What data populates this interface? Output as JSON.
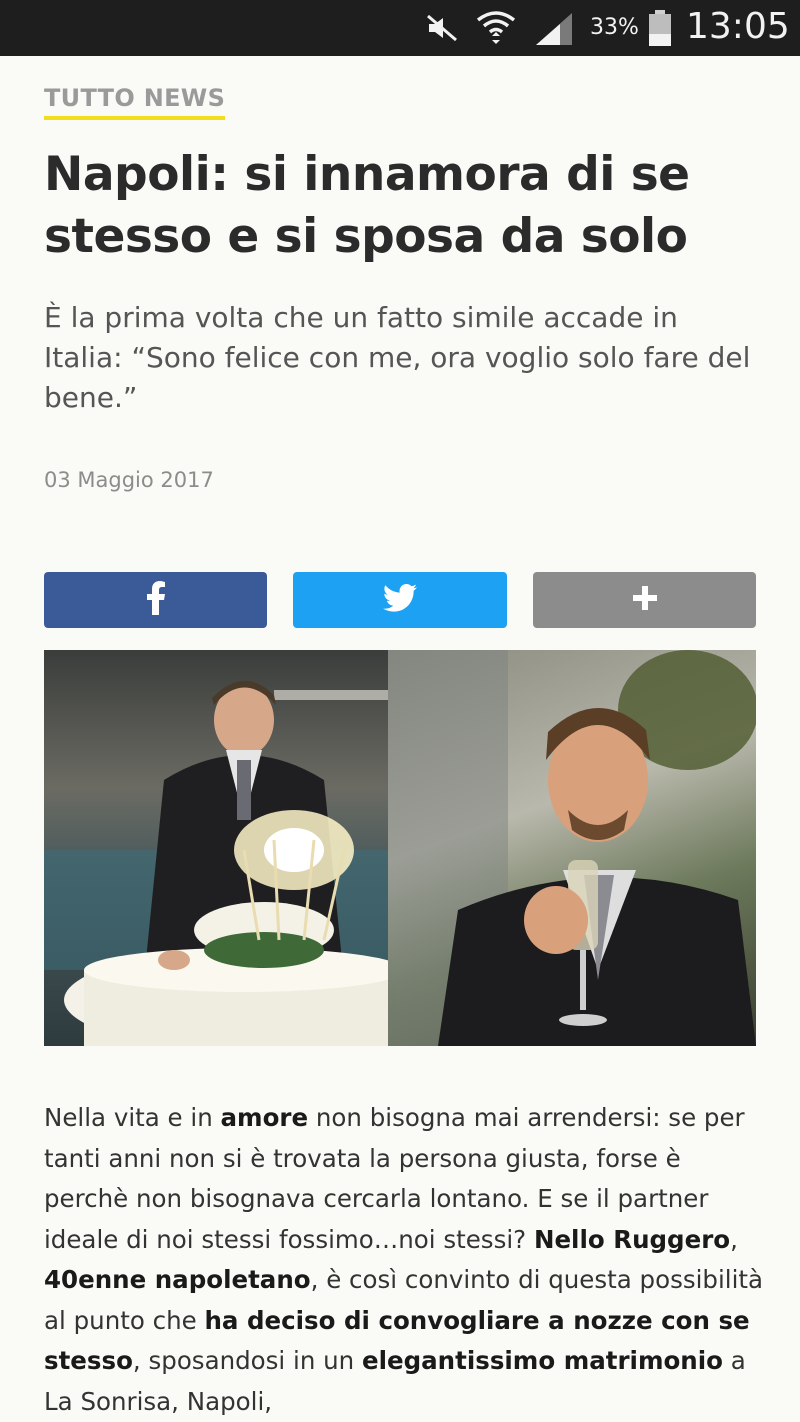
{
  "status_bar": {
    "battery_percent": "33%",
    "time": "13:05",
    "icons": [
      "mute-icon",
      "wifi-icon",
      "signal-icon",
      "battery-icon"
    ]
  },
  "article": {
    "category": "TUTTO NEWS",
    "title": "Napoli: si innamora di se stesso e si sposa da solo",
    "subtitle": "È la prima volta che un fatto simile accade in Italia: “Sono felice con me, ora voglio solo fare del bene.”",
    "date": "03 Maggio 2017",
    "body": [
      {
        "t": "Nella vita e in ",
        "b": false
      },
      {
        "t": "amore",
        "b": true
      },
      {
        "t": " non bisogna mai arrendersi: se per tanti anni non si è trovata la persona giusta, forse è perchè non bisognava cercarla lontano. E se il partner ideale di noi stessi fossimo…noi stessi? ",
        "b": false
      },
      {
        "t": "Nello Ruggero",
        "b": true
      },
      {
        "t": ", ",
        "b": false
      },
      {
        "t": "40enne napoletano",
        "b": true
      },
      {
        "t": ", è così convinto di questa possibilità al punto che ",
        "b": false
      },
      {
        "t": "ha deciso di convogliare a nozze con se stesso",
        "b": true
      },
      {
        "t": ", sposandosi in un ",
        "b": false
      },
      {
        "t": "elegantissimo matrimonio",
        "b": true
      },
      {
        "t": " a La Sonrisa, Napoli,",
        "b": false
      }
    ]
  },
  "share": {
    "facebook_icon": "facebook-icon",
    "twitter_icon": "twitter-icon",
    "more_icon": "plus-icon",
    "colors": {
      "facebook": "#3b5a98",
      "twitter": "#1da1f2",
      "more": "#8c8c8c"
    }
  },
  "accent_color": "#f2dd1e"
}
